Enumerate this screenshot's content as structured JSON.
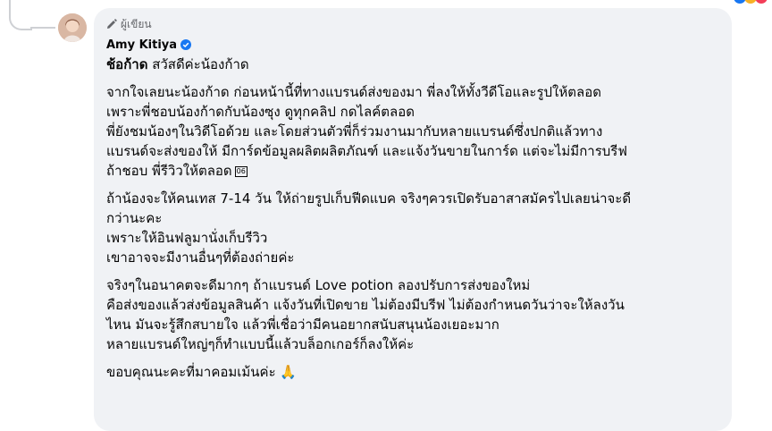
{
  "comment": {
    "badge_label": "ผู้เขียน",
    "author_name": "Amy Kitiya",
    "mention": "ช้อก้าด",
    "greeting_text": " สวัสดีค่ะน้องก้าด",
    "paragraphs": [
      {
        "lines": [
          "จากใจเลยนะน้องก้าด ก่อนหน้านี้ที่ทางแบรนด์ส่งของมา พี่ลงให้ทั้งวีดีโอและรูปให้ตลอด",
          "เพราะพี่ชอบน้องก้าดกับน้องซุง ดูทุกคลิป กดไลค์ตลอด",
          "พี่ยังชมน้องๆในวิดีโอด้วย และโดยส่วนตัวพี่ก็ร่วมงานมากับหลายแบรนด์ซึ่งปกติแล้วทาง",
          "แบรนด์จะส่งของให้ มีการ์ดข้อมูลผลิตผลิตภัณฑ์ และแจ้งวันขายในการ์ด แต่จะไม่มีการบรีฟ",
          "ถ้าชอบ พี่รีวิวให้ตลอด"
        ],
        "tail_symbol": "06"
      },
      {
        "lines": [
          "ถ้าน้องจะให้คนเทส 7-14 วัน ให้ถ่ายรูปเก็บฟีดแบค จริงๆควรเปิดรับอาสาสมัครไปเลยน่าจะดี",
          "กว่านะคะ",
          "เพราะให้อินฟลูมานั่งเก็บรีวิว",
          "เขาอาจจะมีงานอื่นๆที่ต้องถ่ายค่ะ"
        ]
      },
      {
        "lines": [
          "จริงๆในอนาคตจะดีมากๆ ถ้าแบรนด์ Love potion ลองปรับการส่งของใหม่",
          "คือส่งของแล้วส่งข้อมูลสินค้า แจ้งวันที่เปิดขาย ไม่ต้องมีบรีฟ ไม่ต้องกำหนดวันว่าจะให้ลงวัน",
          "ไหน มันจะรู้สึกสบายใจ แล้วพี่เชื่อว่ามีคนอยากสนับสนุนน้องเยอะมาก",
          "หลายแบรนด์ใหญ่ๆก็ทำแบบนี้แล้วบล็อกเกอร์ก็ลงให้ค่ะ"
        ]
      },
      {
        "lines": [
          "ขอบคุณนะคะที่มาคอมเม้นค่ะ 🙏"
        ]
      }
    ],
    "colors": {
      "bubble_bg": "#f0f2f5",
      "verified_blue": "#1877f2",
      "thread_line": "#ced0d4"
    },
    "icons": [
      "pencil-icon",
      "verified-badge-icon",
      "praying-hands-emoji"
    ]
  }
}
